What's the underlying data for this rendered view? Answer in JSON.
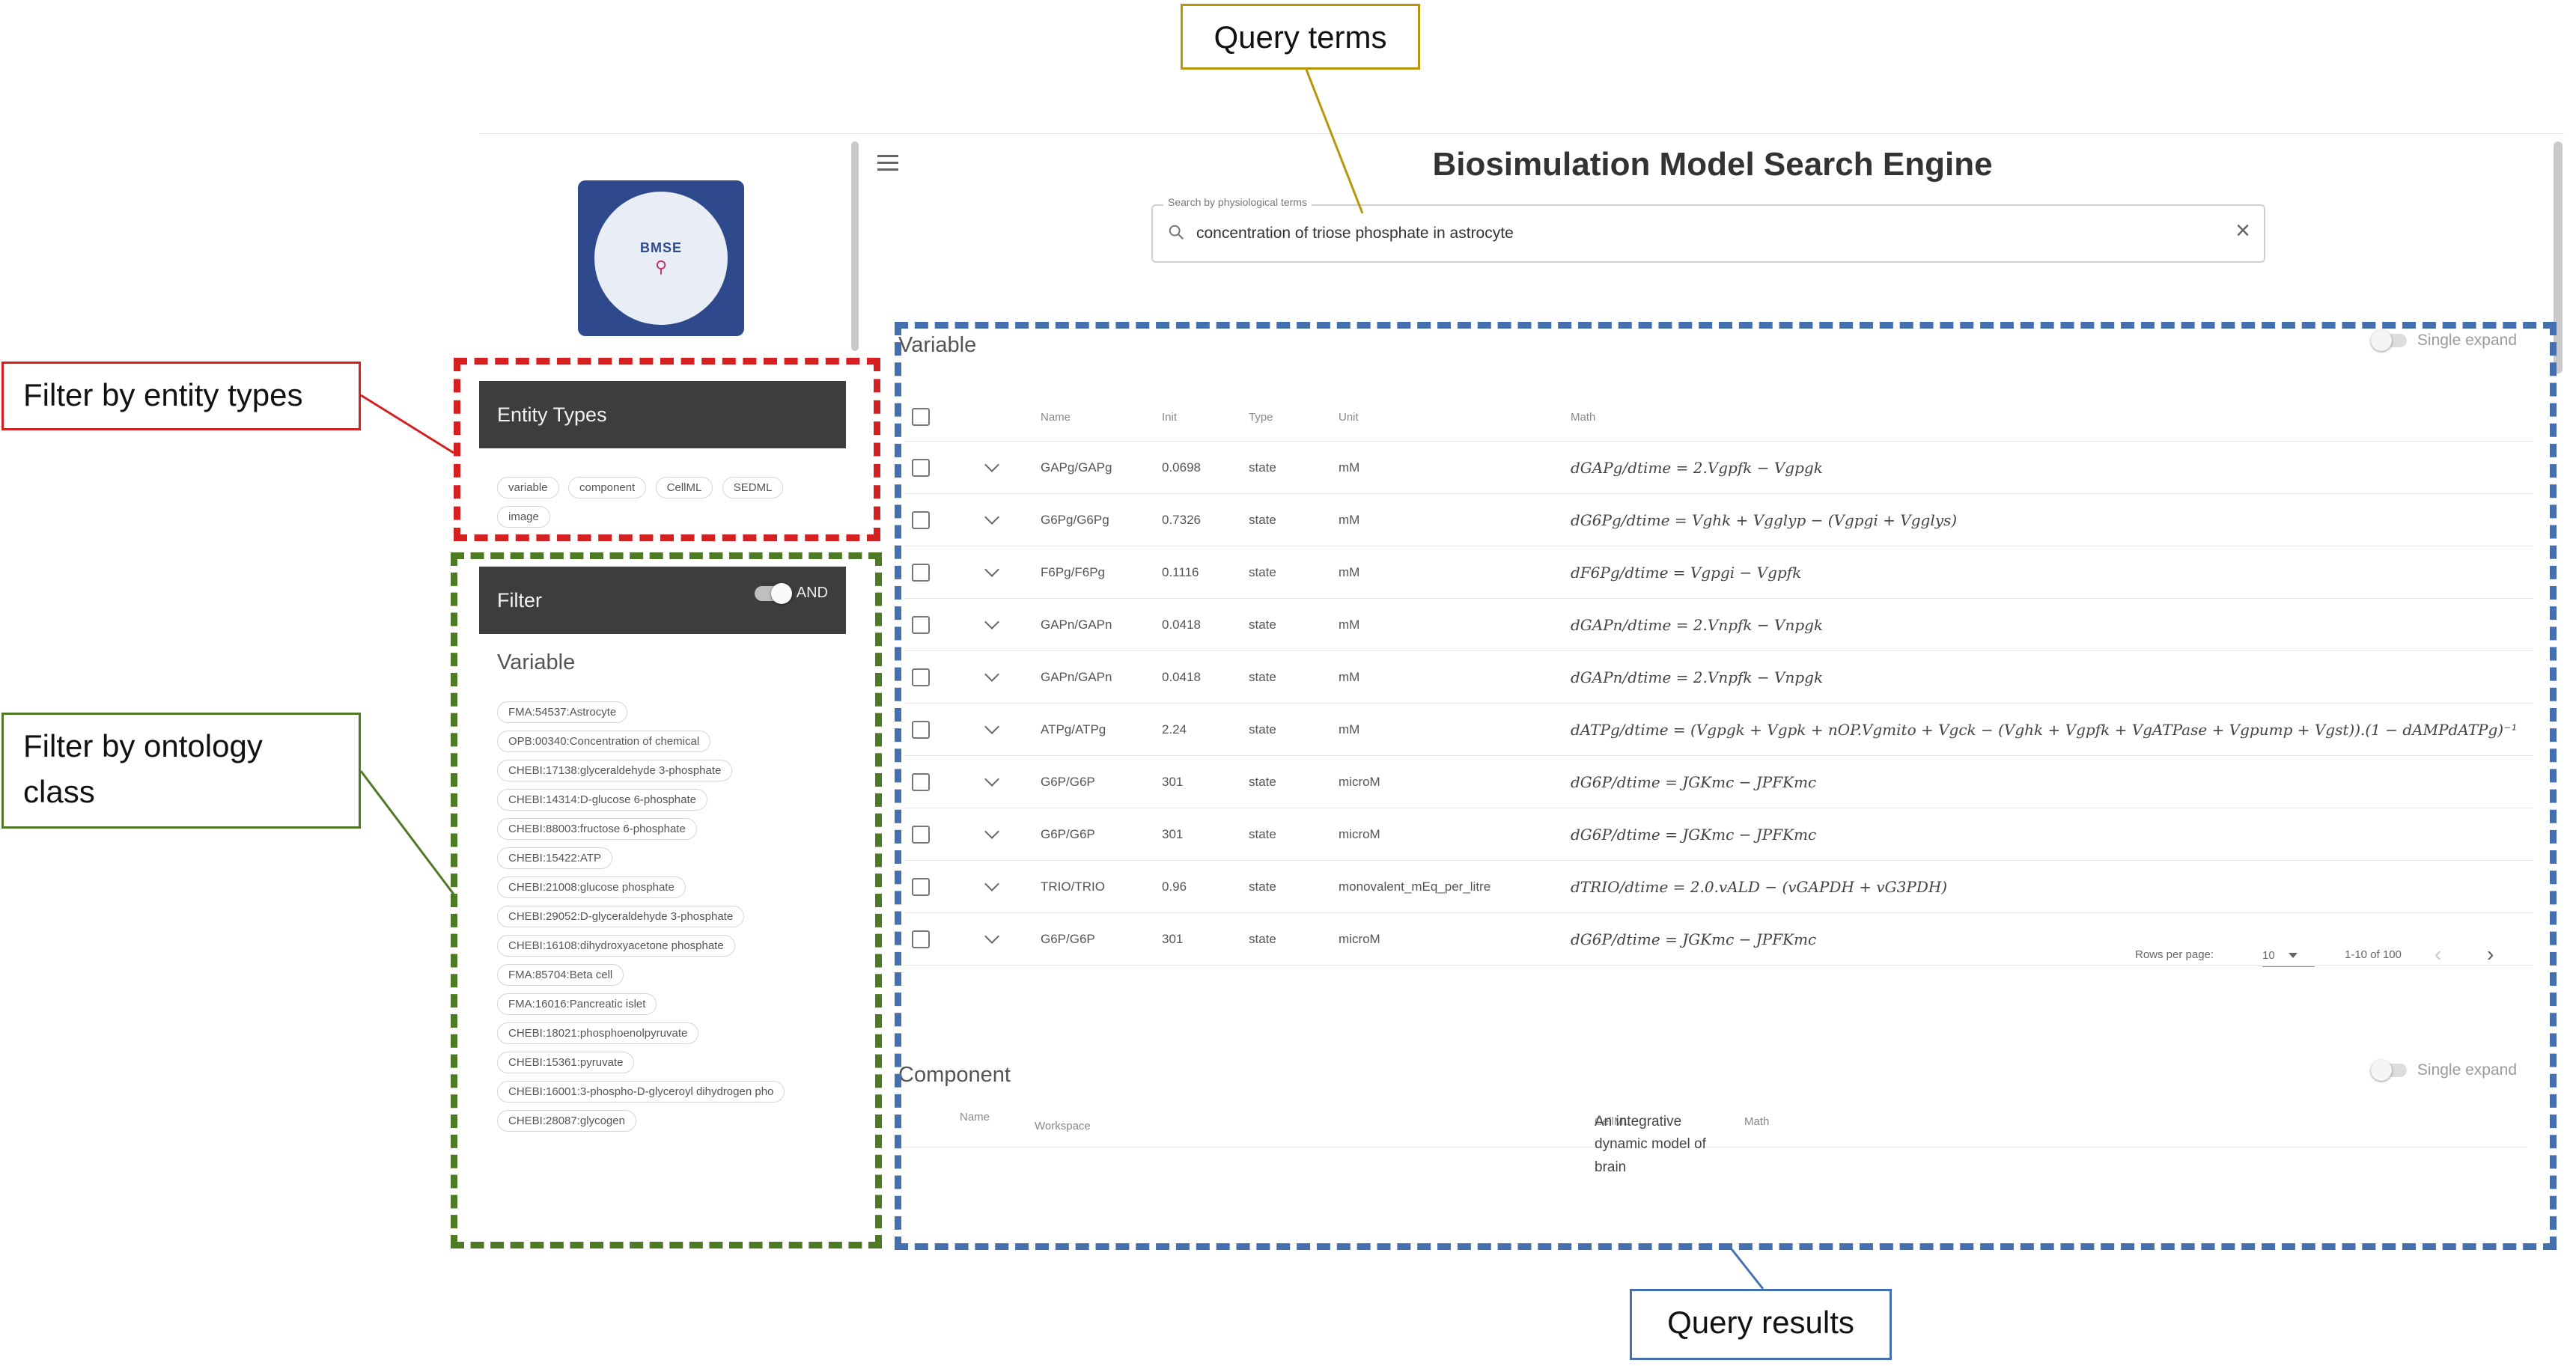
{
  "annotations": {
    "query_terms": "Query terms",
    "filter_entity_types": "Filter by entity types",
    "filter_ontology_class": "Filter by ontology class",
    "query_results": "Query results"
  },
  "logo": {
    "text": "BMSE"
  },
  "app": {
    "title": "Biosimulation Model Search Engine"
  },
  "search": {
    "label": "Search by physiological terms",
    "value": "concentration of triose phosphate in astrocyte",
    "clear": "×"
  },
  "entity_types": {
    "header": "Entity Types",
    "chips": [
      "variable",
      "component",
      "CellML",
      "SEDML",
      "image"
    ]
  },
  "filter": {
    "header": "Filter",
    "toggle_label": "AND",
    "variable_title": "Variable",
    "ontology_chips": [
      "FMA:54537:Astrocyte",
      "OPB:00340:Concentration of chemical",
      "CHEBI:17138:glyceraldehyde 3-phosphate",
      "CHEBI:14314:D-glucose 6-phosphate",
      "CHEBI:88003:fructose 6-phosphate",
      "CHEBI:15422:ATP",
      "CHEBI:21008:glucose phosphate",
      "CHEBI:29052:D-glyceraldehyde 3-phosphate",
      "CHEBI:16108:dihydroxyacetone phosphate",
      "FMA:85704:Beta cell",
      "FMA:16016:Pancreatic islet",
      "CHEBI:18021:phosphoenolpyruvate",
      "CHEBI:15361:pyruvate",
      "CHEBI:16001:3-phospho-D-glyceroyl dihydrogen pho",
      "CHEBI:28087:glycogen"
    ]
  },
  "variable_results": {
    "title": "Variable",
    "single_expand": "Single expand",
    "columns": {
      "name": "Name",
      "init": "Init",
      "type": "Type",
      "unit": "Unit",
      "math": "Math"
    },
    "rows": [
      {
        "name": "GAPg/GAPg",
        "init": "0.0698",
        "type": "state",
        "unit": "mM",
        "math": "dGAPg/dtime = 2.Vgpfk − Vgpgk"
      },
      {
        "name": "G6Pg/G6Pg",
        "init": "0.7326",
        "type": "state",
        "unit": "mM",
        "math": "dG6Pg/dtime = Vghk + Vgglyp − (Vgpgi + Vgglys)"
      },
      {
        "name": "F6Pg/F6Pg",
        "init": "0.1116",
        "type": "state",
        "unit": "mM",
        "math": "dF6Pg/dtime = Vgpgi − Vgpfk"
      },
      {
        "name": "GAPn/GAPn",
        "init": "0.0418",
        "type": "state",
        "unit": "mM",
        "math": "dGAPn/dtime = 2.Vnpfk − Vnpgk"
      },
      {
        "name": "GAPn/GAPn",
        "init": "0.0418",
        "type": "state",
        "unit": "mM",
        "math": "dGAPn/dtime = 2.Vnpfk − Vnpgk"
      },
      {
        "name": "ATPg/ATPg",
        "init": "2.24",
        "type": "state",
        "unit": "mM",
        "math": "dATPg/dtime = (Vgpgk + Vgpk + nOP.Vgmito + Vgck − (Vghk + Vgpfk + VgATPase + Vgpump + Vgst)).(1 − dAMPdATPg)⁻¹"
      },
      {
        "name": "G6P/G6P",
        "init": "301",
        "type": "state",
        "unit": "microM",
        "math": "dG6P/dtime = JGKmc − JPFKmc"
      },
      {
        "name": "G6P/G6P",
        "init": "301",
        "type": "state",
        "unit": "microM",
        "math": "dG6P/dtime = JGKmc − JPFKmc"
      },
      {
        "name": "TRIO/TRIO",
        "init": "0.96",
        "type": "state",
        "unit": "monovalent_mEq_per_litre",
        "math": "dTRIO/dtime = 2.0.vALD − (vGAPDH + vG3PDH)"
      },
      {
        "name": "G6P/G6P",
        "init": "301",
        "type": "state",
        "unit": "microM",
        "math": "dG6P/dtime = JGKmc − JPFKmc"
      }
    ],
    "pagination": {
      "rows_per_page_label": "Rows per page:",
      "rows_per_page": "10",
      "range": "1-10 of 100",
      "prev": "‹",
      "next": "›"
    }
  },
  "component_results": {
    "title": "Component",
    "single_expand": "Single expand",
    "columns": {
      "name": "Name",
      "workspace": "Workspace",
      "cellml": "CellML",
      "math": "Math"
    },
    "first_cellml": "An integrative dynamic model of brain"
  },
  "colors": {
    "query_terms": "#b8960c",
    "entity_types": "#d42020",
    "ontology": "#4e7a25",
    "results": "#4470b0",
    "panel_header": "#3d3d3d",
    "logo": "#2f4a8c"
  },
  "icons": {
    "menu": "hamburger-icon",
    "search": "search-icon",
    "clear": "close-icon",
    "expand": "chevron-down-icon"
  }
}
